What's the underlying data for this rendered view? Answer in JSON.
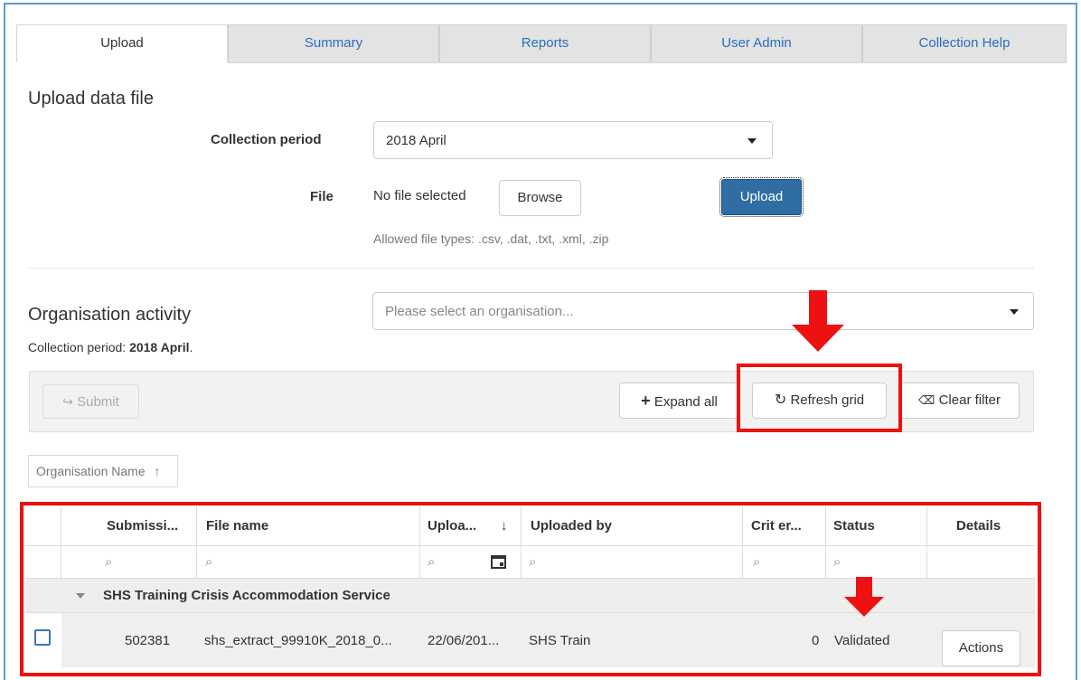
{
  "tabs": [
    {
      "label": "Upload"
    },
    {
      "label": "Summary"
    },
    {
      "label": "Reports"
    },
    {
      "label": "User Admin"
    },
    {
      "label": "Collection Help"
    }
  ],
  "upload": {
    "title": "Upload data file",
    "collection_period_label": "Collection period",
    "collection_period_value": "2018 April",
    "file_label": "File",
    "file_status": "No file selected",
    "browse_label": "Browse",
    "upload_label": "Upload",
    "allowed_types": "Allowed file types: .csv, .dat, .txt, .xml, .zip"
  },
  "org": {
    "title": "Organisation activity",
    "select_placeholder": "Please select an organisation...",
    "period_prefix": "Collection period: ",
    "period_value": "2018 April",
    "period_suffix": "."
  },
  "toolbar": {
    "submit_label": "Submit",
    "expand_label": "Expand all",
    "refresh_label": "Refresh grid",
    "clear_label": "Clear filter"
  },
  "sort": {
    "label": "Organisation Name"
  },
  "grid": {
    "columns": [
      "Submissi...",
      "File name",
      "Uploa...",
      "Uploaded by",
      "Crit er...",
      "Status",
      "Details"
    ],
    "group_label": "SHS Training Crisis Accommodation Service",
    "rows": [
      {
        "submission": "502381",
        "file_name": "shs_extract_99910K_2018_0...",
        "uploaded": "22/06/201...",
        "uploaded_by": "SHS Train",
        "crit_errors": "0",
        "status": "Validated",
        "details_button": "Actions"
      }
    ]
  },
  "colors": {
    "accent": "#2f6ea4",
    "link": "#2a6ebb",
    "highlight": "#ee1111"
  }
}
